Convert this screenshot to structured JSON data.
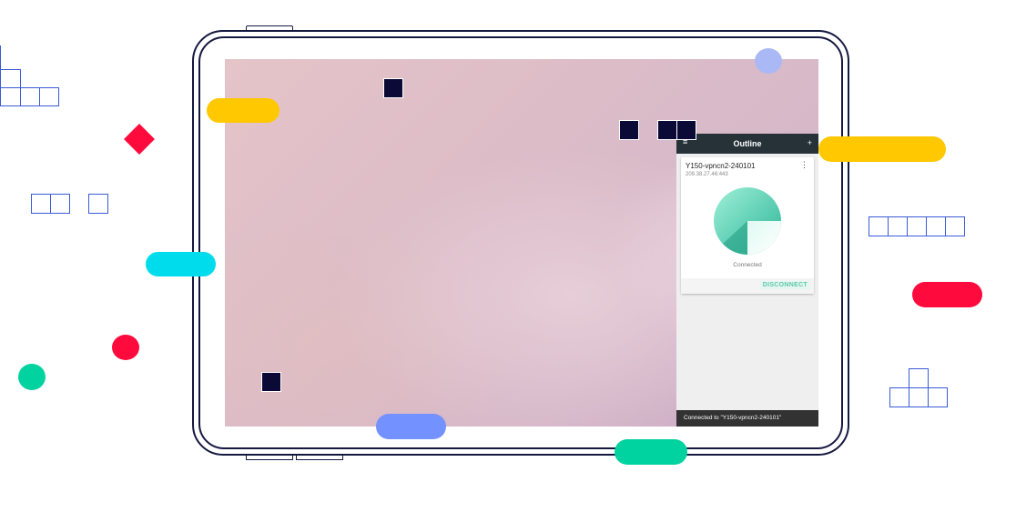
{
  "app": {
    "title": "Outline",
    "menu_icon": "≡",
    "add_icon": "+",
    "server": {
      "name": "Y150-vpncn2-240101",
      "address": "209.38.27.46:443",
      "status": "Connected",
      "disconnect_label": "DISCONNECT"
    },
    "snackbar": "Connected to \"Y150-vpncn2-240101\""
  },
  "colors": {
    "frame": "#14183f",
    "app_bar": "#263238",
    "accent": "#5cc8a8",
    "yellow": "#ffc800",
    "cyan": "#00dceb",
    "red": "#ff0a3c",
    "green": "#00d2a0",
    "blue": "#7391ff",
    "lavender": "#aab9f5"
  }
}
